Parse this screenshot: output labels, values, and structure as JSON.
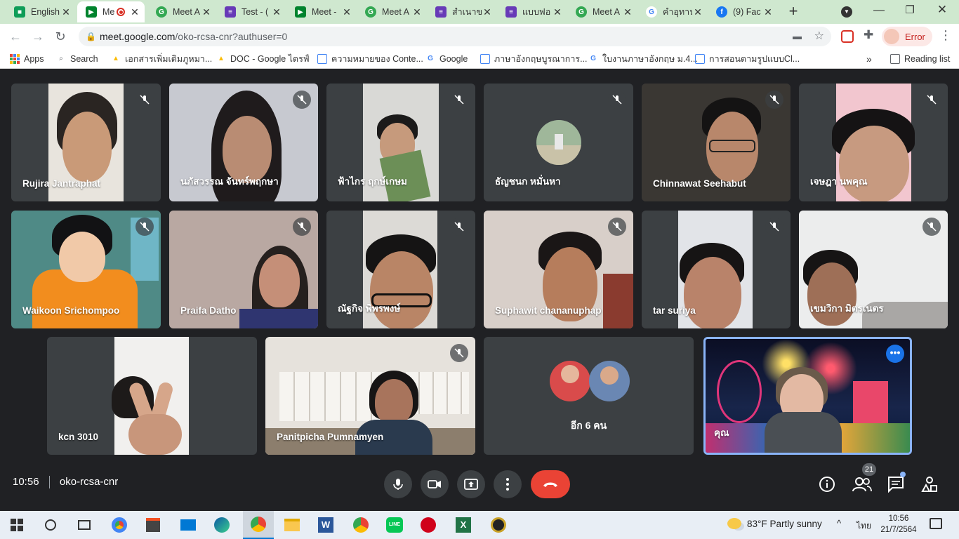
{
  "browser": {
    "tabs": [
      {
        "title": "English",
        "icon": "classroom-icon",
        "color": "#0f9d58"
      },
      {
        "title": "Me",
        "icon": "meet-icon",
        "color": "#00832d",
        "active": true
      },
      {
        "title": "Meet A",
        "icon": "chrome-web-icon",
        "color": "#34a853"
      },
      {
        "title": "Test - (",
        "icon": "forms-icon",
        "color": "#673ab7"
      },
      {
        "title": "Meet -",
        "icon": "meet-icon",
        "color": "#00832d"
      },
      {
        "title": "Meet A",
        "icon": "chrome-web-icon",
        "color": "#34a853"
      },
      {
        "title": "สำเนาข",
        "icon": "forms-icon",
        "color": "#673ab7"
      },
      {
        "title": "แบบฟอ",
        "icon": "forms-icon",
        "color": "#673ab7"
      },
      {
        "title": "Meet A",
        "icon": "chrome-web-icon",
        "color": "#34a853"
      },
      {
        "title": "คำอุทาน",
        "icon": "google-icon",
        "color": "#4285f4"
      },
      {
        "title": "(9) Fac",
        "icon": "facebook-icon",
        "color": "#1877f2"
      }
    ],
    "url_host": "meet.google.com",
    "url_path": "/oko-rcsa-cnr?authuser=0",
    "profile_label": "Error",
    "reading_list": "Reading list",
    "bookmarks": [
      {
        "label": "Apps",
        "icon": "apps-grid-icon"
      },
      {
        "label": "Search",
        "icon": "search-icon"
      },
      {
        "label": "เอกสารเพิ่มเติมภูหมา...",
        "icon": "drive-icon"
      },
      {
        "label": "DOC - Google ไดรฟ์",
        "icon": "drive-icon"
      },
      {
        "label": "ความหมายของ Conte...",
        "icon": "page-icon"
      },
      {
        "label": "Google",
        "icon": "google-icon"
      },
      {
        "label": "ภาษาอังกฤษบูรณาการ...",
        "icon": "page-icon"
      },
      {
        "label": "ใบงานภาษาอังกฤษ ม.4...",
        "icon": "google-icon"
      },
      {
        "label": "การสอนตามรูปแบบCl...",
        "icon": "page-icon"
      }
    ]
  },
  "meet": {
    "participants": [
      {
        "name": "Rujira Jantraphat",
        "muted": true
      },
      {
        "name": "นภัสวรรณ จันทร์พฤกษา",
        "muted": true
      },
      {
        "name": "ฟ้าไกร ฤกษ์เกษม",
        "muted": true
      },
      {
        "name": "ธัญชนก หมั่นหา",
        "muted": true
      },
      {
        "name": "Chinnawat Seehabut",
        "muted": true
      },
      {
        "name": "เจษฎา นพคุณ",
        "muted": true
      },
      {
        "name": "Waikoon Srichompoo",
        "muted": true
      },
      {
        "name": "Praifa Datho",
        "muted": true
      },
      {
        "name": "ณัฐกิจ พิพรพงษ์",
        "muted": true
      },
      {
        "name": "Suphawit chananuphap",
        "muted": true
      },
      {
        "name": "tar suriya",
        "muted": true
      },
      {
        "name": "เขมวิกา มิตรเนตร",
        "muted": true
      },
      {
        "name": "kcn 3010",
        "muted": false
      },
      {
        "name": "Panitpicha Pumnamyen",
        "muted": true
      },
      {
        "name": "อีก 6 คน",
        "muted": false
      },
      {
        "name": "คุณ",
        "muted": false
      }
    ],
    "time": "10:56",
    "meeting_code": "oko-rcsa-cnr",
    "participant_count": "21",
    "end_call_color": "#ea4335"
  },
  "taskbar": {
    "weather_temp": "83°F",
    "weather_text": "Partly sunny",
    "language": "ไทย",
    "clock_time": "10:56",
    "clock_date": "21/7/2564"
  }
}
